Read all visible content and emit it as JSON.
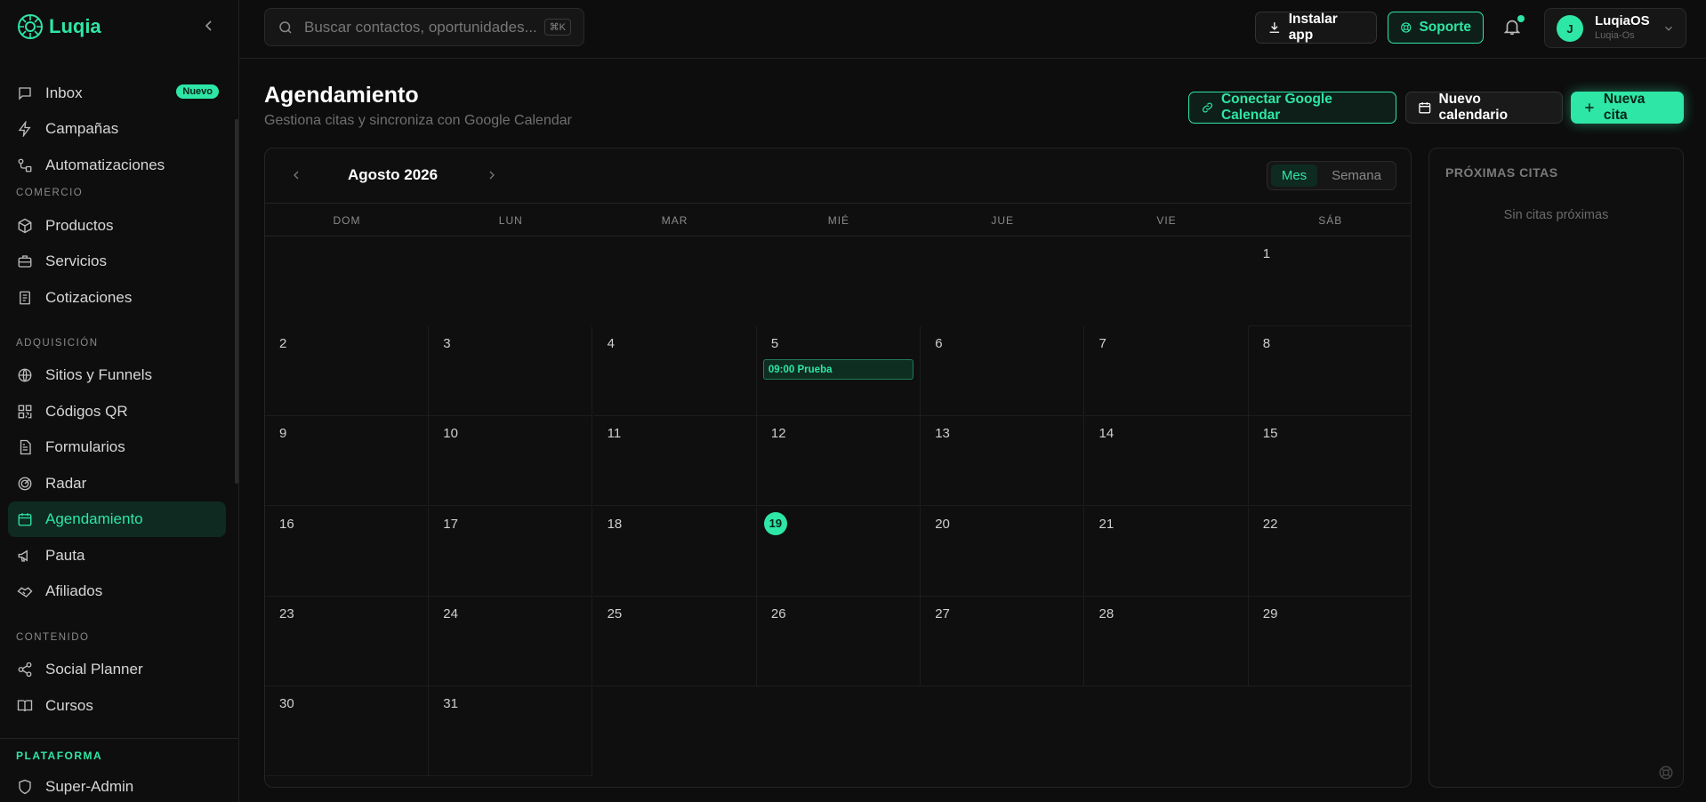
{
  "brand": {
    "name": "Luqia",
    "accent": "#2ee6a6"
  },
  "sidebar": {
    "items": [
      {
        "label": "Inbox",
        "badge": "Nuevo",
        "icon": "message-square-icon"
      },
      {
        "label": "Campañas",
        "icon": "zap-icon"
      },
      {
        "label": "Automatizaciones",
        "icon": "workflow-icon"
      },
      {
        "label": "Productos",
        "icon": "package-icon"
      },
      {
        "label": "Servicios",
        "icon": "briefcase-icon"
      },
      {
        "label": "Cotizaciones",
        "icon": "receipt-icon"
      },
      {
        "label": "Sitios y Funnels",
        "icon": "globe-icon"
      },
      {
        "label": "Códigos QR",
        "icon": "qr-code-icon"
      },
      {
        "label": "Formularios",
        "icon": "file-text-icon"
      },
      {
        "label": "Radar",
        "icon": "radar-icon"
      },
      {
        "label": "Agendamiento",
        "icon": "calendar-icon",
        "active": true
      },
      {
        "label": "Pauta",
        "icon": "megaphone-icon"
      },
      {
        "label": "Afiliados",
        "icon": "handshake-icon"
      },
      {
        "label": "Social Planner",
        "icon": "share-icon"
      },
      {
        "label": "Cursos",
        "icon": "book-open-icon"
      }
    ],
    "sections": {
      "comercio": "COMERCIO",
      "adquisicion": "ADQUISICIÓN",
      "contenido": "CONTENIDO"
    },
    "bottom": {
      "section": "PLATAFORMA",
      "item": "Super-Admin"
    }
  },
  "topbar": {
    "search_placeholder": "Buscar contactos, oportunidades...",
    "search_shortcut": "⌘K",
    "install_label": "Instalar app",
    "support_label": "Soporte",
    "user": {
      "initial": "J",
      "name": "LuqiaOS",
      "sub": "Luqia-Os"
    }
  },
  "page": {
    "title": "Agendamiento",
    "subtitle": "Gestiona citas y sincroniza con Google Calendar",
    "connect_label": "Conectar Google Calendar",
    "new_calendar_label": "Nuevo calendario",
    "new_appt_label": "Nueva cita"
  },
  "calendar": {
    "month_label": "Agosto 2026",
    "views": {
      "month": "Mes",
      "week": "Semana"
    },
    "weekdays": [
      "DOM",
      "LUN",
      "MAR",
      "MIÉ",
      "JUE",
      "VIE",
      "SÁB"
    ],
    "days": [
      "",
      "",
      "",
      "",
      "",
      "",
      "1",
      "2",
      "3",
      "4",
      "5",
      "6",
      "7",
      "8",
      "9",
      "10",
      "11",
      "12",
      "13",
      "14",
      "15",
      "16",
      "17",
      "18",
      "19",
      "20",
      "21",
      "22",
      "23",
      "24",
      "25",
      "26",
      "27",
      "28",
      "29",
      "30",
      "31"
    ],
    "today": "19",
    "event": {
      "day": "5",
      "label": "09:00 Prueba"
    }
  },
  "upcoming": {
    "title": "PRÓXIMAS CITAS",
    "empty": "Sin citas próximas"
  }
}
